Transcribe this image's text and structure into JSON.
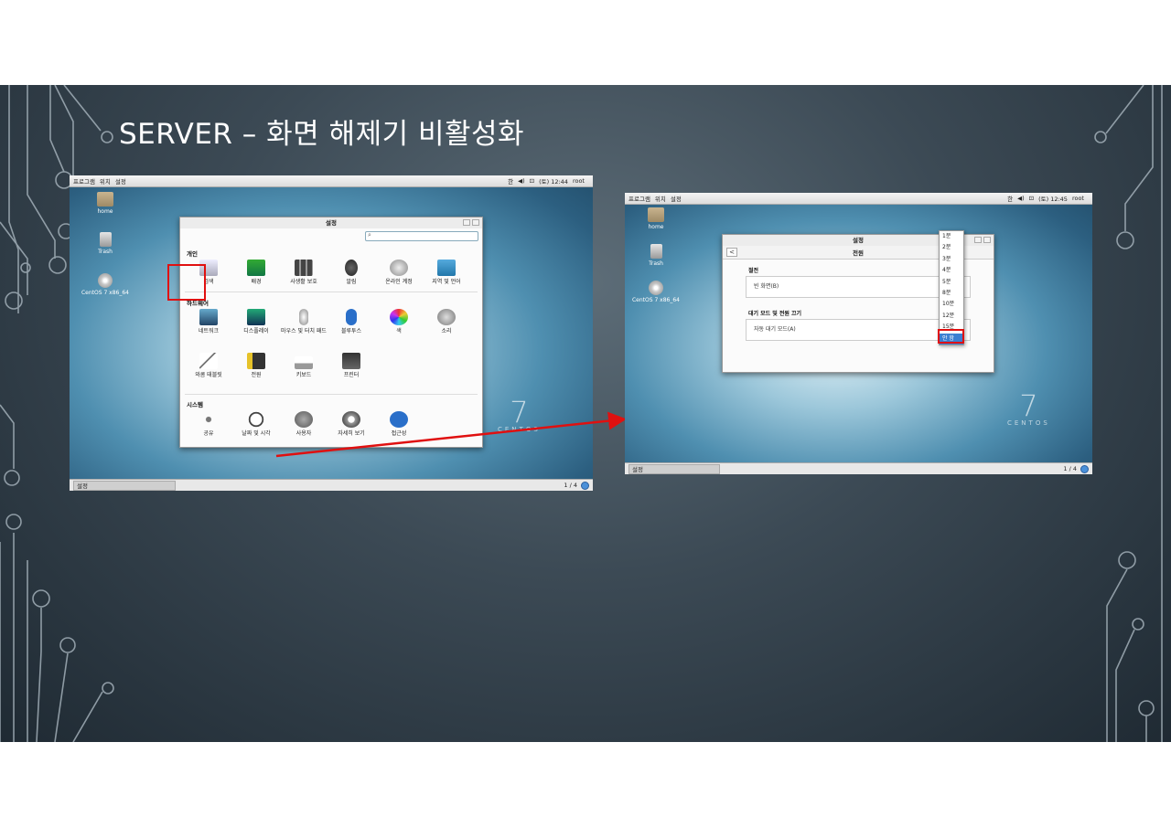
{
  "slide": {
    "title": "SERVER – 화면 해제기 비활성화"
  },
  "screen1": {
    "topbar": {
      "apps": "프로그램",
      "places": "위치",
      "active_app": "설정",
      "lang": "한",
      "volume": "◀)",
      "network": "⊡",
      "clock": "(토) 12:44",
      "user": "root"
    },
    "desktop_icons": [
      {
        "label": "home"
      },
      {
        "label": "Trash"
      },
      {
        "label": "CentOS 7 x86_64"
      }
    ],
    "brand": {
      "number": "7",
      "word": "CENTOS"
    },
    "window": {
      "title": "설정",
      "search_placeholder": "",
      "sections": [
        {
          "label": "개인",
          "items": [
            "검색",
            "배경",
            "사생활 보호",
            "알림",
            "온라인 계정",
            "지역 및 언어"
          ]
        },
        {
          "label": "하드웨어",
          "items": [
            "네트워크",
            "디스플레이",
            "마우스 및 터치 패드",
            "블루투스",
            "색",
            "소리",
            "와콤 태블릿",
            "전원",
            "키보드",
            "프린터"
          ]
        },
        {
          "label": "시스템",
          "items": [
            "공유",
            "날짜 및 시각",
            "사용자",
            "자세히 보기",
            "접근성"
          ]
        }
      ]
    },
    "botbar": {
      "task": "설정",
      "pager": "1 / 4"
    }
  },
  "screen2": {
    "topbar": {
      "apps": "프로그램",
      "places": "위치",
      "active_app": "설정",
      "lang": "한",
      "volume": "◀)",
      "network": "⊡",
      "clock": "(토) 12:45",
      "user": "root"
    },
    "desktop_icons": [
      {
        "label": "home"
      },
      {
        "label": "Trash"
      },
      {
        "label": "CentOS 7 x86_64"
      }
    ],
    "brand": {
      "number": "7",
      "word": "CENTOS"
    },
    "window": {
      "title": "설정",
      "back": "<",
      "subtitle": "전원",
      "group1_label": "절전",
      "blank_screen_label": "빈 화면(B)",
      "group2_label": "대기 모드 및 전원 끄기",
      "auto_suspend_label": "자동 대기 모드(A)"
    },
    "dropdown_options": [
      "1분",
      "2분",
      "3분",
      "4분",
      "5분",
      "8분",
      "10분",
      "12분",
      "15분",
      "안 함"
    ],
    "dropdown_selected": "안 함",
    "botbar": {
      "task": "설정",
      "pager": "1 / 4"
    }
  },
  "colors": {
    "highlight": "#e01010",
    "selection": "#3c7fd1"
  }
}
